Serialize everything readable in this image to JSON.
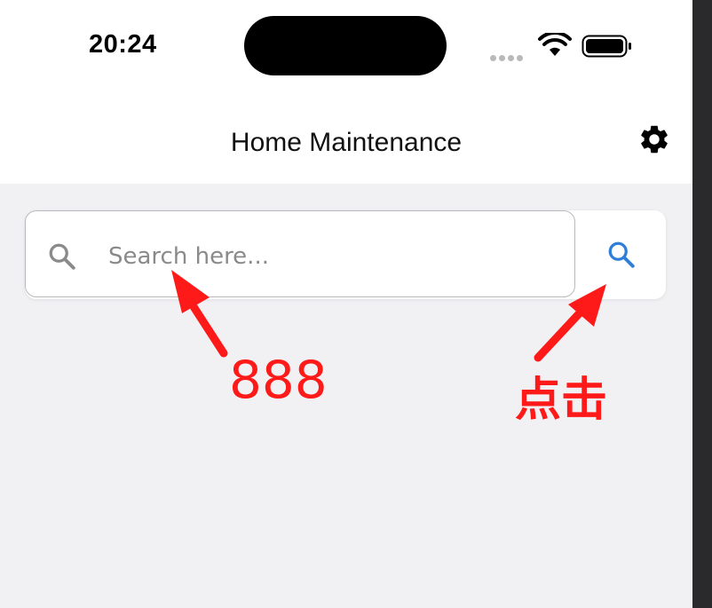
{
  "status_bar": {
    "time": "20:24"
  },
  "navbar": {
    "title": "Home Maintenance",
    "settings_icon": "gear-icon"
  },
  "search": {
    "placeholder": "Search here...",
    "value": "",
    "leading_icon": "search-icon",
    "button_icon": "search-icon"
  },
  "annotations": {
    "input_note": "888",
    "button_note": "点击"
  },
  "colors": {
    "accent": "#2f7fd8",
    "annotation": "#ff1a1a",
    "background": "#f1f1f4"
  }
}
